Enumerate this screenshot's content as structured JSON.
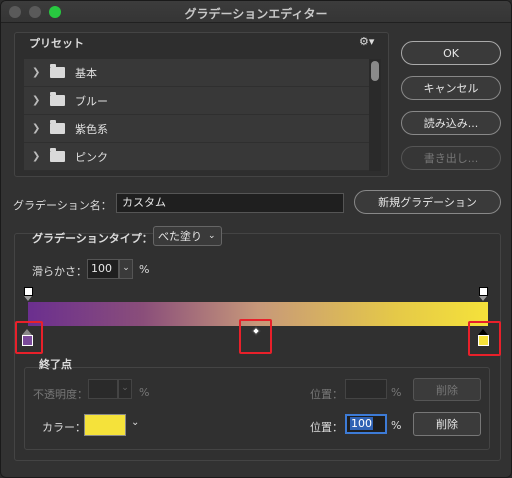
{
  "window": {
    "title": "グラデーションエディター"
  },
  "presets": {
    "label": "プリセット",
    "items": [
      {
        "label": "基本"
      },
      {
        "label": "ブルー"
      },
      {
        "label": "紫色系"
      },
      {
        "label": "ピンク"
      }
    ]
  },
  "buttons": {
    "ok": "OK",
    "cancel": "キャンセル",
    "load": "読み込み...",
    "save": "書き出し...",
    "new_gradient": "新規グラデーション"
  },
  "name": {
    "label": "グラデーション名：",
    "value": "カスタム"
  },
  "gradient_type": {
    "label": "グラデーションタイプ：",
    "value": "べた塗り"
  },
  "smoothness": {
    "label": "滑らかさ：",
    "value": "100",
    "unit": "%"
  },
  "gradient": {
    "colors": {
      "start": "#6b2f8f",
      "end": "#f5e23a"
    },
    "highlight_color": "#e8202a"
  },
  "stops": {
    "section_label": "終了点",
    "opacity_label": "不透明度：",
    "opacity_value": "",
    "opacity_unit": "%",
    "opacity_location_label": "位置：",
    "opacity_location_value": "",
    "opacity_location_unit": "%",
    "delete_label": "削除",
    "color_label": "カラー：",
    "color_value": "#f5e23a",
    "color_location_label": "位置：",
    "color_location_value": "100",
    "color_location_unit": "%",
    "color_delete_label": "削除"
  }
}
